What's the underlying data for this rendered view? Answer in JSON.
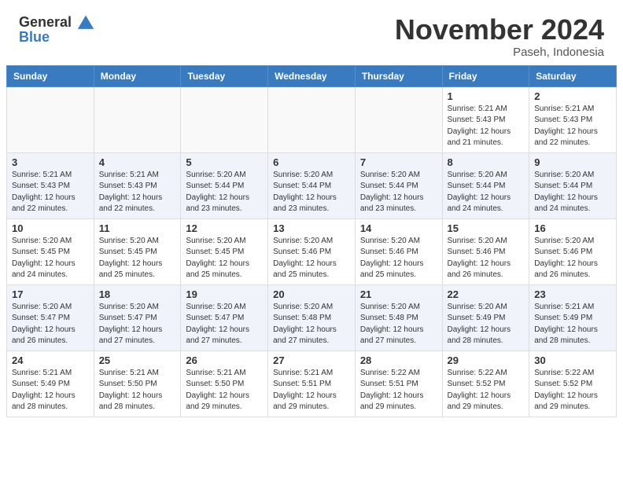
{
  "header": {
    "logo_line1": "General",
    "logo_line2": "Blue",
    "month": "November 2024",
    "location": "Paseh, Indonesia"
  },
  "days_of_week": [
    "Sunday",
    "Monday",
    "Tuesday",
    "Wednesday",
    "Thursday",
    "Friday",
    "Saturday"
  ],
  "weeks": [
    [
      {
        "day": "",
        "info": ""
      },
      {
        "day": "",
        "info": ""
      },
      {
        "day": "",
        "info": ""
      },
      {
        "day": "",
        "info": ""
      },
      {
        "day": "",
        "info": ""
      },
      {
        "day": "1",
        "info": "Sunrise: 5:21 AM\nSunset: 5:43 PM\nDaylight: 12 hours\nand 21 minutes."
      },
      {
        "day": "2",
        "info": "Sunrise: 5:21 AM\nSunset: 5:43 PM\nDaylight: 12 hours\nand 22 minutes."
      }
    ],
    [
      {
        "day": "3",
        "info": "Sunrise: 5:21 AM\nSunset: 5:43 PM\nDaylight: 12 hours\nand 22 minutes."
      },
      {
        "day": "4",
        "info": "Sunrise: 5:21 AM\nSunset: 5:43 PM\nDaylight: 12 hours\nand 22 minutes."
      },
      {
        "day": "5",
        "info": "Sunrise: 5:20 AM\nSunset: 5:44 PM\nDaylight: 12 hours\nand 23 minutes."
      },
      {
        "day": "6",
        "info": "Sunrise: 5:20 AM\nSunset: 5:44 PM\nDaylight: 12 hours\nand 23 minutes."
      },
      {
        "day": "7",
        "info": "Sunrise: 5:20 AM\nSunset: 5:44 PM\nDaylight: 12 hours\nand 23 minutes."
      },
      {
        "day": "8",
        "info": "Sunrise: 5:20 AM\nSunset: 5:44 PM\nDaylight: 12 hours\nand 24 minutes."
      },
      {
        "day": "9",
        "info": "Sunrise: 5:20 AM\nSunset: 5:44 PM\nDaylight: 12 hours\nand 24 minutes."
      }
    ],
    [
      {
        "day": "10",
        "info": "Sunrise: 5:20 AM\nSunset: 5:45 PM\nDaylight: 12 hours\nand 24 minutes."
      },
      {
        "day": "11",
        "info": "Sunrise: 5:20 AM\nSunset: 5:45 PM\nDaylight: 12 hours\nand 25 minutes."
      },
      {
        "day": "12",
        "info": "Sunrise: 5:20 AM\nSunset: 5:45 PM\nDaylight: 12 hours\nand 25 minutes."
      },
      {
        "day": "13",
        "info": "Sunrise: 5:20 AM\nSunset: 5:46 PM\nDaylight: 12 hours\nand 25 minutes."
      },
      {
        "day": "14",
        "info": "Sunrise: 5:20 AM\nSunset: 5:46 PM\nDaylight: 12 hours\nand 25 minutes."
      },
      {
        "day": "15",
        "info": "Sunrise: 5:20 AM\nSunset: 5:46 PM\nDaylight: 12 hours\nand 26 minutes."
      },
      {
        "day": "16",
        "info": "Sunrise: 5:20 AM\nSunset: 5:46 PM\nDaylight: 12 hours\nand 26 minutes."
      }
    ],
    [
      {
        "day": "17",
        "info": "Sunrise: 5:20 AM\nSunset: 5:47 PM\nDaylight: 12 hours\nand 26 minutes."
      },
      {
        "day": "18",
        "info": "Sunrise: 5:20 AM\nSunset: 5:47 PM\nDaylight: 12 hours\nand 27 minutes."
      },
      {
        "day": "19",
        "info": "Sunrise: 5:20 AM\nSunset: 5:47 PM\nDaylight: 12 hours\nand 27 minutes."
      },
      {
        "day": "20",
        "info": "Sunrise: 5:20 AM\nSunset: 5:48 PM\nDaylight: 12 hours\nand 27 minutes."
      },
      {
        "day": "21",
        "info": "Sunrise: 5:20 AM\nSunset: 5:48 PM\nDaylight: 12 hours\nand 27 minutes."
      },
      {
        "day": "22",
        "info": "Sunrise: 5:20 AM\nSunset: 5:49 PM\nDaylight: 12 hours\nand 28 minutes."
      },
      {
        "day": "23",
        "info": "Sunrise: 5:21 AM\nSunset: 5:49 PM\nDaylight: 12 hours\nand 28 minutes."
      }
    ],
    [
      {
        "day": "24",
        "info": "Sunrise: 5:21 AM\nSunset: 5:49 PM\nDaylight: 12 hours\nand 28 minutes."
      },
      {
        "day": "25",
        "info": "Sunrise: 5:21 AM\nSunset: 5:50 PM\nDaylight: 12 hours\nand 28 minutes."
      },
      {
        "day": "26",
        "info": "Sunrise: 5:21 AM\nSunset: 5:50 PM\nDaylight: 12 hours\nand 29 minutes."
      },
      {
        "day": "27",
        "info": "Sunrise: 5:21 AM\nSunset: 5:51 PM\nDaylight: 12 hours\nand 29 minutes."
      },
      {
        "day": "28",
        "info": "Sunrise: 5:22 AM\nSunset: 5:51 PM\nDaylight: 12 hours\nand 29 minutes."
      },
      {
        "day": "29",
        "info": "Sunrise: 5:22 AM\nSunset: 5:52 PM\nDaylight: 12 hours\nand 29 minutes."
      },
      {
        "day": "30",
        "info": "Sunrise: 5:22 AM\nSunset: 5:52 PM\nDaylight: 12 hours\nand 29 minutes."
      }
    ]
  ]
}
